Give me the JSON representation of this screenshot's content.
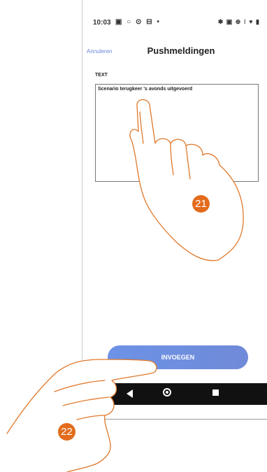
{
  "topmarks": "✕☑",
  "status": {
    "time": "10:03",
    "left_icons": "▣ ○ ⊙ ⊟ •",
    "right_icons": "✱ ▣ ⊕ ⁝ ♥ ▮"
  },
  "header": {
    "cancel_label": "Annuleren",
    "title": "Pushmeldingen"
  },
  "field": {
    "label": "TEXT",
    "value": "Scenario terugkeer 's avonds uitgevoerd"
  },
  "insert_button_label": "INVOEGEN",
  "badges": {
    "first": "21",
    "second": "22"
  },
  "colors": {
    "accent": "#6f8ce0",
    "badge": "#e26c1c",
    "hand_outline": "#e0782a"
  }
}
